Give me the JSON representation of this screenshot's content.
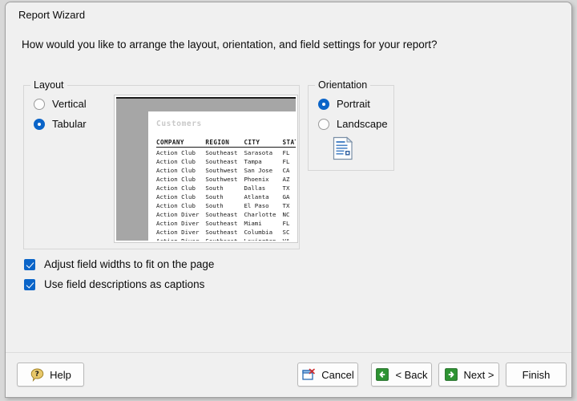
{
  "window": {
    "title": "Report Wizard"
  },
  "prompt": "How would you like to arrange the layout, orientation, and field settings for your report?",
  "layout_group": {
    "legend": "Layout",
    "options": [
      {
        "label": "Vertical",
        "selected": false
      },
      {
        "label": "Tabular",
        "selected": true
      }
    ]
  },
  "preview": {
    "caption": "Customers",
    "columns": [
      "COMPANY",
      "REGION",
      "CITY",
      "STATE"
    ],
    "rows": [
      [
        "Action Club",
        "Southeast",
        "Sarasota",
        "FL"
      ],
      [
        "Action Club",
        "Southeast",
        "Tampa",
        "FL"
      ],
      [
        "Action Club",
        "Southwest",
        "San Jose",
        "CA"
      ],
      [
        "Action Club",
        "Southwest",
        "Phoenix",
        "AZ"
      ],
      [
        "Action Club",
        "South",
        "Dallas",
        "TX"
      ],
      [
        "Action Club",
        "South",
        "Atlanta",
        "GA"
      ],
      [
        "Action Club",
        "South",
        "El Paso",
        "TX"
      ],
      [
        "Action Diver",
        "Southeast",
        "Charlotte",
        "NC"
      ],
      [
        "Action Diver",
        "Southeast",
        "Miami",
        "FL"
      ],
      [
        "Action Diver",
        "Southeast",
        "Columbia",
        "SC"
      ],
      [
        "Action Diver",
        "Southeast",
        "Lexington",
        "VA"
      ]
    ]
  },
  "orientation_group": {
    "legend": "Orientation",
    "options": [
      {
        "label": "Portrait",
        "selected": true
      },
      {
        "label": "Landscape",
        "selected": false
      }
    ],
    "icon": "document-portrait-icon"
  },
  "checkboxes": [
    {
      "label": "Adjust field widths to fit on the page",
      "checked": true
    },
    {
      "label": "Use field descriptions as captions",
      "checked": true
    }
  ],
  "footer": {
    "help_label": "Help",
    "cancel_label": "Cancel",
    "back_label": "< Back",
    "next_label": "Next >",
    "finish_label": "Finish"
  },
  "colors": {
    "accent": "#0a64c8",
    "nav_green": "#2e9433",
    "help_gold": "#e8c86a",
    "cancel_red": "#d42a2a",
    "window_bg": "#f0f0f0",
    "preview_gray": "#a6a6a6"
  }
}
